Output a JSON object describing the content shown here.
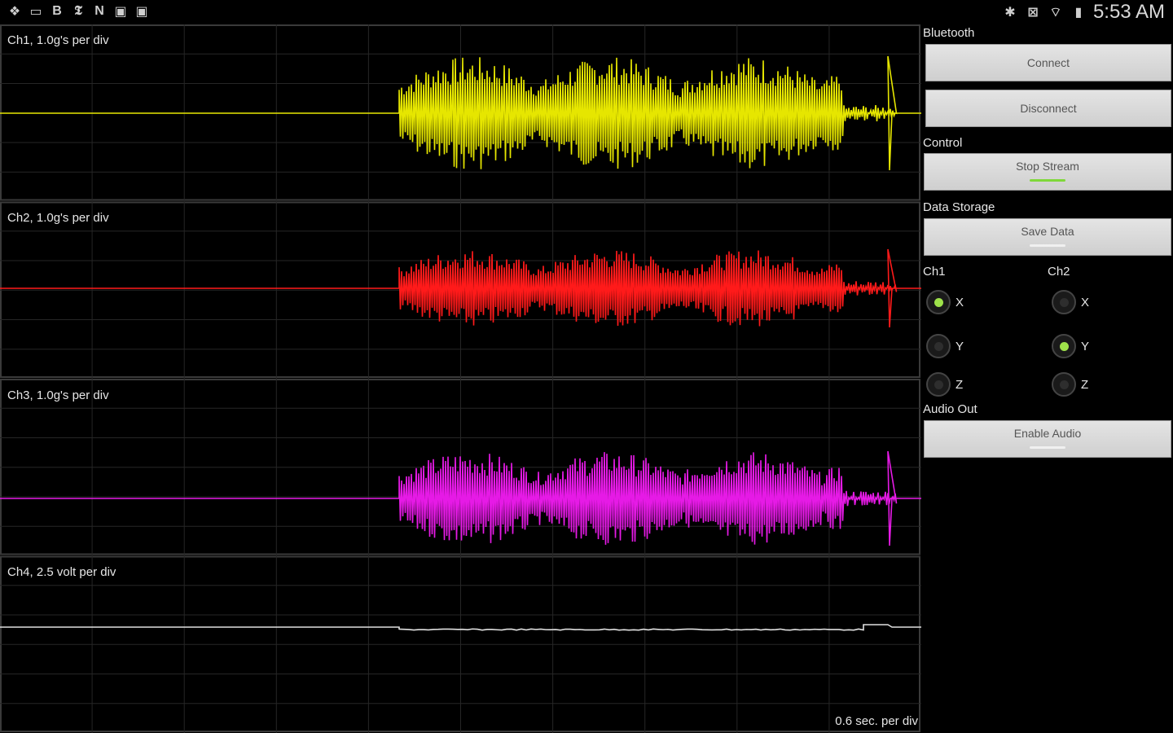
{
  "status_bar": {
    "left_icons": [
      "dropbox-icon",
      "screen-icon",
      "b-icon",
      "nyt-icon",
      "n-icon",
      "photo-icon",
      "gallery-icon"
    ],
    "right_icons": [
      "bluetooth-icon",
      "nfc-icon",
      "wifi-icon",
      "battery-icon"
    ],
    "time": "5:53 AM"
  },
  "scope": {
    "channels": [
      {
        "label": "Ch1, 1.0g's per div",
        "color": "#e6e600"
      },
      {
        "label": "Ch2, 1.0g's per div",
        "color": "#ff1a1a"
      },
      {
        "label": "Ch3, 1.0g's per div",
        "color": "#e61ae6"
      },
      {
        "label": "Ch4, 2.5 volt per div",
        "color": "#e0e0e0"
      }
    ],
    "timebase": "0.6 sec. per div"
  },
  "panel": {
    "bluetooth": {
      "heading": "Bluetooth",
      "connect": "Connect",
      "disconnect": "Disconnect"
    },
    "control": {
      "heading": "Control",
      "stop_stream": "Stop Stream"
    },
    "storage": {
      "heading": "Data Storage",
      "save_data": "Save Data"
    },
    "ch1": {
      "heading": "Ch1",
      "options": [
        "X",
        "Y",
        "Z"
      ],
      "selected": "X"
    },
    "ch2": {
      "heading": "Ch2",
      "options": [
        "X",
        "Y",
        "Z"
      ],
      "selected": "Y"
    },
    "audio": {
      "heading": "Audio Out",
      "enable_audio": "Enable Audio"
    },
    "colors": {
      "indicator_on": "#7fd83a",
      "indicator_off": "#f0f0f0"
    }
  }
}
